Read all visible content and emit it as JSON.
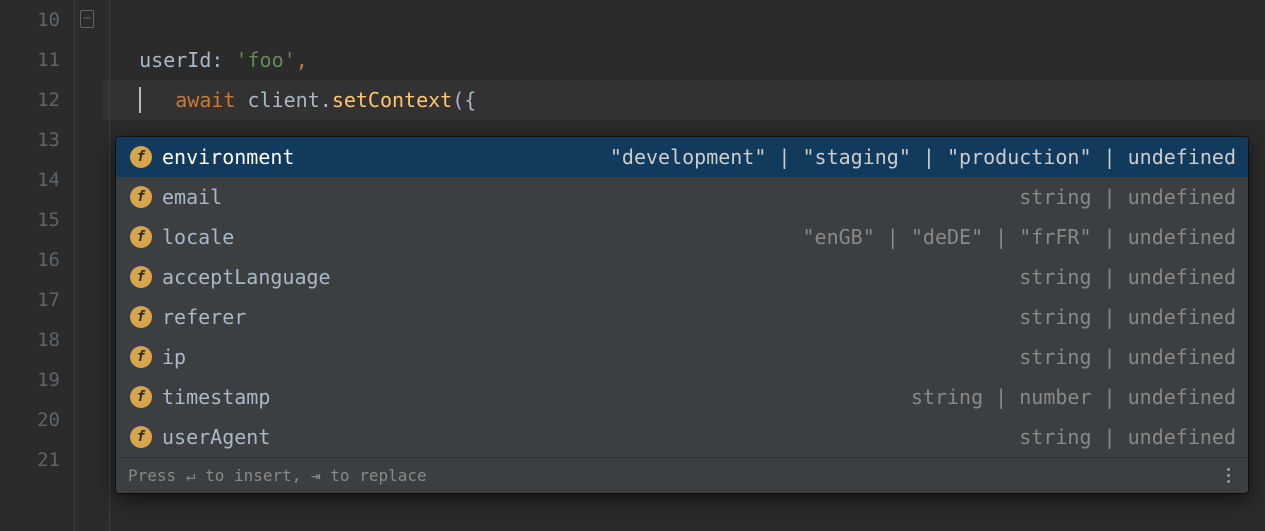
{
  "gutter": {
    "lines": [
      "10",
      "11",
      "12",
      "13",
      "14",
      "15",
      "16",
      "17",
      "18",
      "19",
      "20",
      "21"
    ]
  },
  "code": {
    "line10": {
      "await": "await",
      "space1": " ",
      "client": "client",
      "dot": ".",
      "method": "setContext",
      "open": "({"
    },
    "line11": {
      "indent": "   ",
      "prop": "userId",
      "colon": ": ",
      "str": "'foo'",
      "comma": ","
    },
    "line12": {
      "indent": "   "
    }
  },
  "completion": {
    "items": [
      {
        "icon": "f",
        "name": "environment",
        "type": "\"development\" | \"staging\" | \"production\" | undefined",
        "selected": true
      },
      {
        "icon": "f",
        "name": "email",
        "type": "string | undefined",
        "selected": false
      },
      {
        "icon": "f",
        "name": "locale",
        "type": "\"enGB\" | \"deDE\" | \"frFR\" | undefined",
        "selected": false
      },
      {
        "icon": "f",
        "name": "acceptLanguage",
        "type": "string | undefined",
        "selected": false
      },
      {
        "icon": "f",
        "name": "referer",
        "type": "string | undefined",
        "selected": false
      },
      {
        "icon": "f",
        "name": "ip",
        "type": "string | undefined",
        "selected": false
      },
      {
        "icon": "f",
        "name": "timestamp",
        "type": "string | number | undefined",
        "selected": false
      },
      {
        "icon": "f",
        "name": "userAgent",
        "type": "string | undefined",
        "selected": false
      }
    ],
    "footer_hint": "Press ↵ to insert, ⇥ to replace"
  }
}
